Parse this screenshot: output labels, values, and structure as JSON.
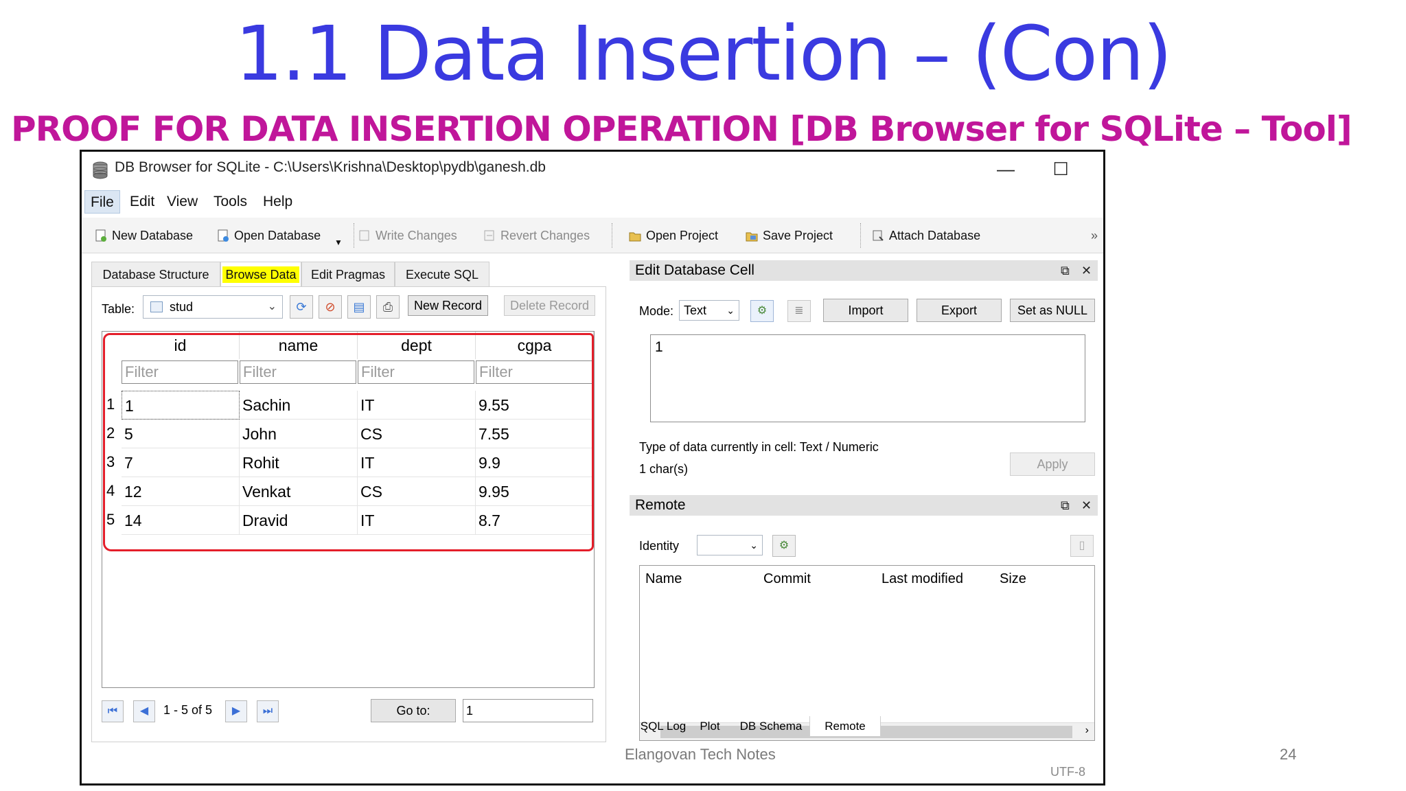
{
  "slide": {
    "title": "1.1 Data Insertion – (Con)",
    "subtitle": "PROOF FOR DATA INSERTION OPERATION [DB Browser for SQLite – Tool]",
    "watermark": "Elangovan Tech Notes",
    "page_number": "24",
    "colors": {
      "title": "#3a3ae0",
      "subtitle": "#c0169a",
      "annotation_box": "#e41e2a",
      "highlight": "#ffff00"
    }
  },
  "window": {
    "title": "DB Browser for SQLite - C:\\Users\\Krishna\\Desktop\\pydb\\ganesh.db",
    "controls": {
      "minimize": "—",
      "maximize": "☐",
      "close": "✕"
    }
  },
  "menu": [
    "File",
    "Edit",
    "View",
    "Tools",
    "Help"
  ],
  "toolbar": {
    "new_database": "New Database",
    "open_database": "Open Database",
    "write_changes": "Write Changes",
    "revert_changes": "Revert Changes",
    "open_project": "Open Project",
    "save_project": "Save Project",
    "attach_database": "Attach Database",
    "overflow": "»"
  },
  "tabs": [
    "Database Structure",
    "Browse Data",
    "Edit Pragmas",
    "Execute SQL"
  ],
  "browse": {
    "table_label": "Table:",
    "table_value": "stud",
    "new_record": "New Record",
    "delete_record": "Delete Record",
    "columns": [
      "id",
      "name",
      "dept",
      "cgpa"
    ],
    "filter_placeholder": "Filter",
    "rows": [
      {
        "num": "1",
        "id": "1",
        "name": "Sachin",
        "dept": "IT",
        "cgpa": "9.55"
      },
      {
        "num": "2",
        "id": "5",
        "name": "John",
        "dept": "CS",
        "cgpa": "7.55"
      },
      {
        "num": "3",
        "id": "7",
        "name": "Rohit",
        "dept": "IT",
        "cgpa": "9.9"
      },
      {
        "num": "4",
        "id": "12",
        "name": "Venkat",
        "dept": "CS",
        "cgpa": "9.95"
      },
      {
        "num": "5",
        "id": "14",
        "name": "Dravid",
        "dept": "IT",
        "cgpa": "8.7"
      }
    ],
    "record_range": "1 - 5 of 5",
    "goto_label": "Go to:",
    "goto_value": "1"
  },
  "edit_cell": {
    "header": "Edit Database Cell",
    "mode_label": "Mode:",
    "mode_value": "Text",
    "import": "Import",
    "export": "Export",
    "set_null": "Set as NULL",
    "cell_value": "1",
    "type_info": "Type of data currently in cell: Text / Numeric",
    "char_count": "1 char(s)",
    "apply": "Apply"
  },
  "remote": {
    "header": "Remote",
    "identity_label": "Identity",
    "columns": [
      "Name",
      "Commit",
      "Last modified",
      "Size"
    ]
  },
  "bottom_tabs": [
    "SQL Log",
    "Plot",
    "DB Schema",
    "Remote"
  ],
  "status": {
    "encoding": "UTF-8"
  }
}
